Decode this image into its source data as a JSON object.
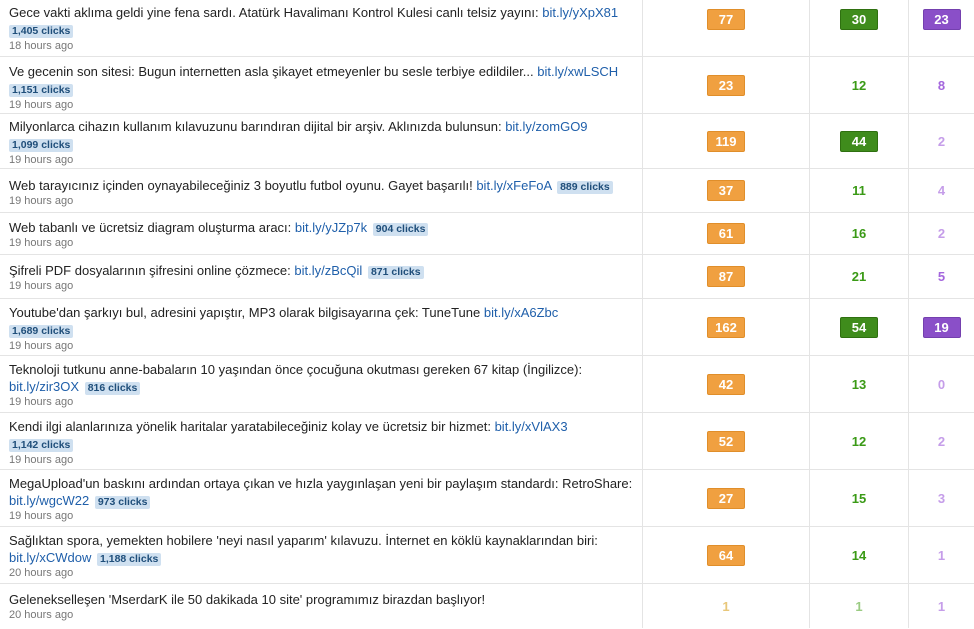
{
  "colors": {
    "orange": "#f0a040",
    "green": "#3f8c1c",
    "purple": "#8a4fc8",
    "link": "#1f5faa",
    "clicks_bg": "#cfe0f0"
  },
  "rows": [
    {
      "text": "Gece vakti aklıma geldi yine fena sardı. Atatürk Havalimanı Kontrol Kulesi canlı telsiz yayını:",
      "link": "bit.ly/yXpX81",
      "clicks": "1,405 clicks",
      "time": "18 hours ago",
      "a": "77",
      "b": "30",
      "c": "23"
    },
    {
      "text": "Ve gecenin son sitesi: Bugun internetten asla şikayet etmeyenler bu sesle terbiye edildiler...",
      "link": "bit.ly/xwLSCH",
      "clicks": "1,151 clicks",
      "time": "19 hours ago",
      "a": "23",
      "b": "12",
      "c": "8"
    },
    {
      "text": "Milyonlarca cihazın kullanım kılavuzunu barındıran dijital bir arşiv. Aklınızda bulunsun:",
      "link": "bit.ly/zomGO9",
      "clicks": "1,099 clicks",
      "time": "19 hours ago",
      "a": "119",
      "b": "44",
      "c": "2"
    },
    {
      "text": "Web tarayıcınız içinden oynayabileceğiniz 3 boyutlu futbol oyunu. Gayet başarılı!",
      "link": "bit.ly/xFeFoA",
      "clicks": "889 clicks",
      "time": "19 hours ago",
      "a": "37",
      "b": "11",
      "c": "4"
    },
    {
      "text": "Web tabanlı ve ücretsiz diagram oluşturma aracı:",
      "link": "bit.ly/yJZp7k",
      "clicks": "904 clicks",
      "time": "19 hours ago",
      "a": "61",
      "b": "16",
      "c": "2"
    },
    {
      "text": "Şifreli PDF dosyalarının şifresini online çözmece:",
      "link": "bit.ly/zBcQil",
      "clicks": "871 clicks",
      "time": "19 hours ago",
      "a": "87",
      "b": "21",
      "c": "5"
    },
    {
      "text": "Youtube'dan şarkıyı bul, adresini yapıştır, MP3 olarak bilgisayarına çek: TuneTune",
      "link": "bit.ly/xA6Zbc",
      "clicks": "1,689 clicks",
      "time": "19 hours ago",
      "a": "162",
      "b": "54",
      "c": "19"
    },
    {
      "text": "Teknoloji tutkunu anne-babaların 10 yaşından önce çocuğuna okutması gereken 67 kitap (İngilizce):",
      "link": "bit.ly/zir3OX",
      "clicks": "816 clicks",
      "time": "19 hours ago",
      "a": "42",
      "b": "13",
      "c": "0"
    },
    {
      "text": "Kendi ilgi alanlarınıza yönelik haritalar yaratabileceğiniz kolay ve ücretsiz bir hizmet:",
      "link": "bit.ly/xVlAX3",
      "clicks": "1,142 clicks",
      "time": "19 hours ago",
      "a": "52",
      "b": "12",
      "c": "2"
    },
    {
      "text": "MegaUpload'un baskını ardından ortaya çıkan ve hızla yaygınlaşan yeni bir paylaşım standardı: RetroShare:",
      "link": "bit.ly/wgcW22",
      "clicks": "973 clicks",
      "time": "19 hours ago",
      "a": "27",
      "b": "15",
      "c": "3"
    },
    {
      "text": "Sağlıktan spora, yemekten hobilere 'neyi nasıl yaparım' kılavuzu. İnternet en köklü kaynaklarından biri:",
      "link": "bit.ly/xCWdow",
      "clicks": "1,188 clicks",
      "time": "20 hours ago",
      "a": "64",
      "b": "14",
      "c": "1"
    },
    {
      "text": "Gelenekselleşen 'MserdarK ile 50 dakikada 10 site' programımız birazdan başlıyor!",
      "link": "",
      "clicks": "",
      "time": "20 hours ago",
      "a": "1",
      "b": "1",
      "c": "1"
    }
  ]
}
